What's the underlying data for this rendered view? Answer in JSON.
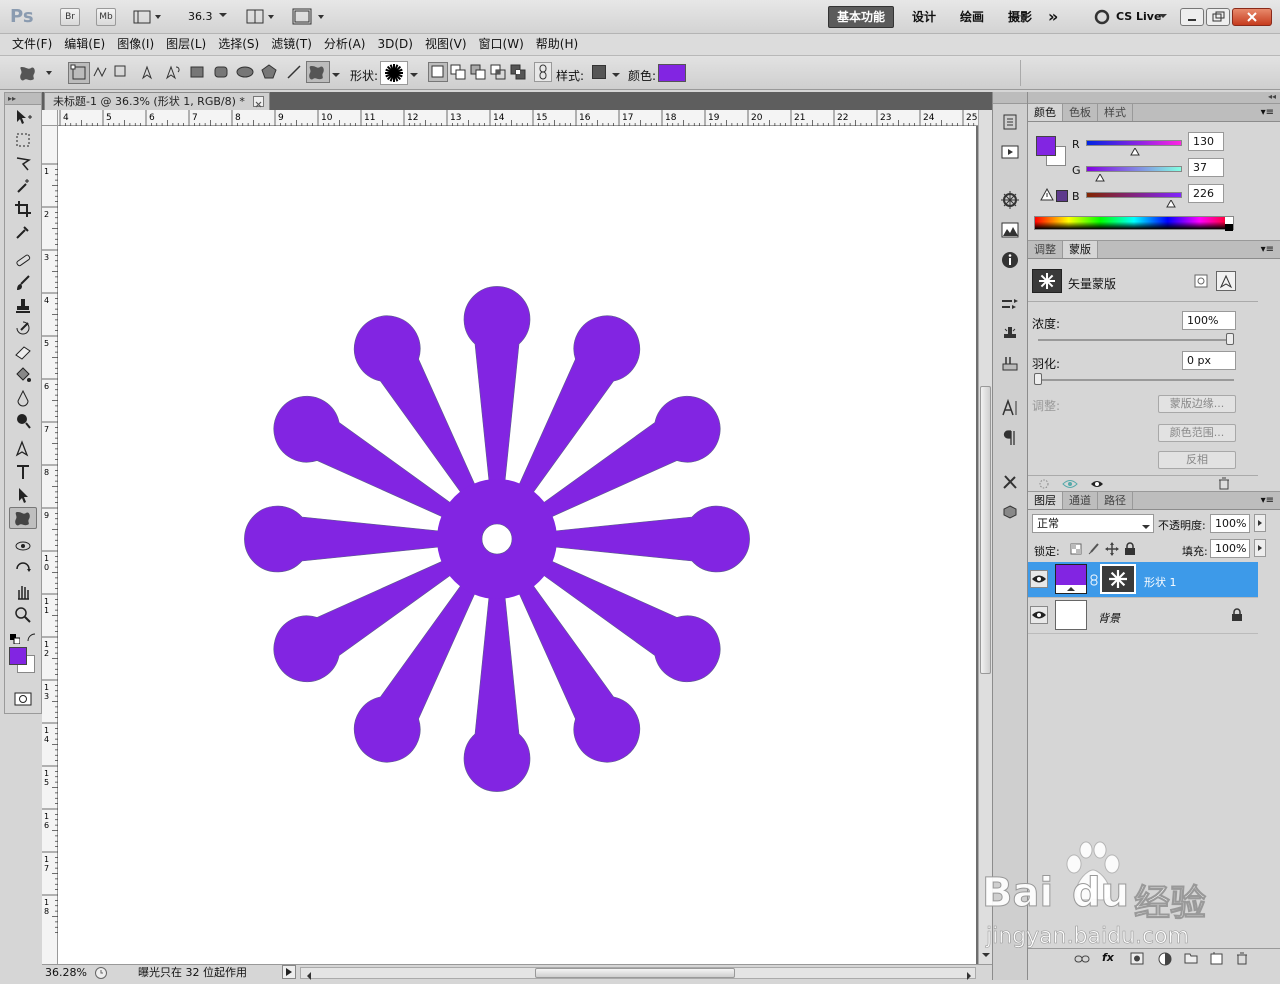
{
  "app_bar": {
    "logo": "Ps",
    "br": "Br",
    "mb": "Mb",
    "zoom": "36.3",
    "workspaces": [
      "基本功能",
      "设计",
      "绘画",
      "摄影"
    ],
    "more": "»",
    "cs_live": "CS Live"
  },
  "menu": [
    "文件(F)",
    "编辑(E)",
    "图像(I)",
    "图层(L)",
    "选择(S)",
    "滤镜(T)",
    "分析(A)",
    "3D(D)",
    "视图(V)",
    "窗口(W)",
    "帮助(H)"
  ],
  "options": {
    "shape_label": "形状:",
    "style_label": "样式:",
    "color_label": "颜色:",
    "color": "#8225e2"
  },
  "document": {
    "tab_title": "未标题-1 @ 36.3% (形状 1, RGB/8) *",
    "ruler_top": [
      "4",
      "5",
      "6",
      "7",
      "8",
      "9",
      "10",
      "11",
      "12",
      "13",
      "14",
      "15",
      "16",
      "17",
      "18",
      "19",
      "20",
      "21",
      "22",
      "23",
      "24",
      "25"
    ],
    "ruler_left": [
      "1",
      "2",
      "3",
      "4",
      "5",
      "6",
      "7",
      "8",
      "9",
      "10",
      "11",
      "12",
      "13",
      "14",
      "15",
      "16",
      "17",
      "18"
    ],
    "shape_fill": "#8225e2"
  },
  "status": {
    "zoom": "36.28%",
    "message": "曝光只在 32 位起作用"
  },
  "color_panel": {
    "tabs": [
      "颜色",
      "色板",
      "样式"
    ],
    "r_label": "R",
    "r": "130",
    "g_label": "G",
    "g": "37",
    "b_label": "B",
    "b": "226",
    "fg": "#8225e2"
  },
  "masks_panel": {
    "tabs": [
      "调整",
      "蒙版"
    ],
    "title": "矢量蒙版",
    "density_label": "浓度:",
    "density": "100%",
    "feather_label": "羽化:",
    "feather": "0 px",
    "refine_label": "调整:",
    "mask_edge": "蒙版边缘...",
    "color_range": "颜色范围...",
    "invert": "反相"
  },
  "layers_panel": {
    "tabs": [
      "图层",
      "通道",
      "路径"
    ],
    "blend_mode": "正常",
    "opacity_label": "不透明度:",
    "opacity": "100%",
    "lock_label": "锁定:",
    "fill_label": "填充:",
    "fill": "100%",
    "layers": [
      {
        "name": "形状 1",
        "selected": true
      },
      {
        "name": "背景",
        "selected": false
      }
    ]
  },
  "watermark": {
    "brand_left": "Bai",
    "brand_right": "du",
    "label": "经验",
    "url": "jingyan.baidu.com"
  }
}
